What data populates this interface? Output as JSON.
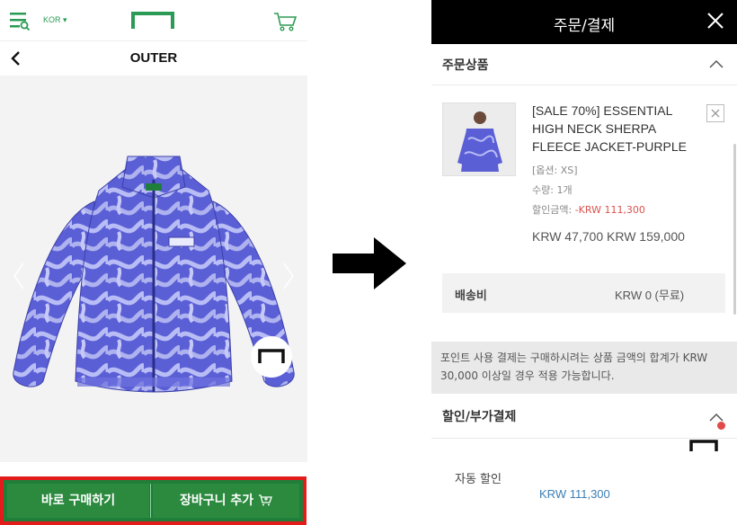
{
  "left": {
    "language": "KOR",
    "page_title": "OUTER",
    "cta_buy_now": "바로 구매하기",
    "cta_add_to_cart": "장바구니 추가"
  },
  "right": {
    "header_title": "주문/결제",
    "order_section_title": "주문상품",
    "product": {
      "name": "[SALE 70%] ESSENTIAL HIGH NECK SHERPA FLEECE JACKET-PURPLE",
      "option": "[옵션: XS]",
      "quantity": "수량: 1개",
      "discount_label": "할인금액: ",
      "discount_value": "-KRW 111,300",
      "price_line": "KRW 47,700 KRW 159,000"
    },
    "shipping_label": "배송비",
    "shipping_value": "KRW 0 (무료)",
    "points_notice": "포인트 사용 결제는 구매하시려는 상품 금액의 합계가 KRW 30,000 이상일 경우 적용 가능합니다.",
    "discount_section_title": "할인/부가결제",
    "auto_discount_label": "자동 할인",
    "auto_discount_value": "KRW 111,300"
  },
  "colors": {
    "brand_green": "#2b8a3e",
    "highlight_red": "#e21b1b",
    "jacket_base": "#5b5fd6",
    "jacket_swirl": "#b9bdf5",
    "discount_red": "#d9534f",
    "link_blue": "#3c7fb6"
  }
}
